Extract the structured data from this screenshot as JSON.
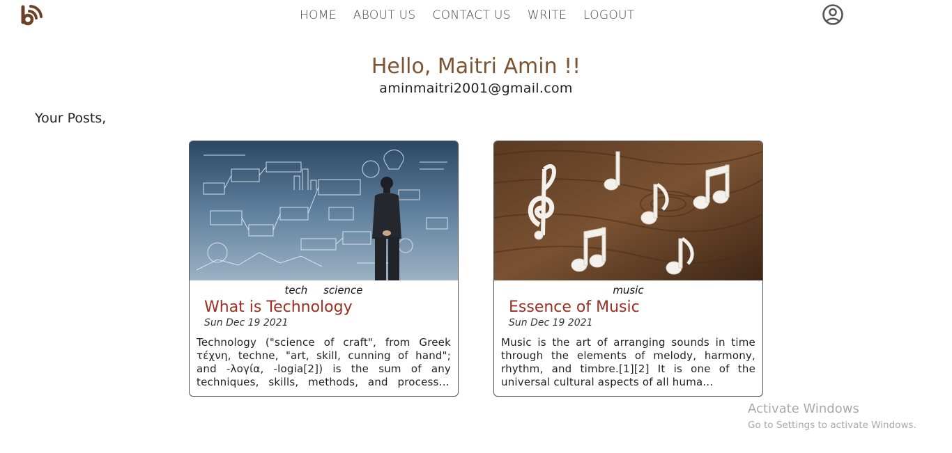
{
  "nav": {
    "logo_icon": "blog-feed-icon",
    "items": [
      "HOME",
      "ABOUT US",
      "CONTACT US",
      "WRITE",
      "LOGOUT"
    ],
    "profile_icon": "user-circle-icon"
  },
  "profile": {
    "greeting": "Hello, Maitri Amin !!",
    "email": "aminmaitri2001@gmail.com",
    "section_label": "Your Posts,"
  },
  "posts": [
    {
      "image": "technology-blueprint-man-photo",
      "categories": [
        "tech",
        "science"
      ],
      "title": "What is Technology",
      "date": "Sun Dec 19 2021",
      "excerpt": "Technology (\"science of craft\", from Greek τέχνη, techne, \"art, skill, cunning of hand\"; and -λογία, -logia[2]) is the sum of any techniques, skills, methods, and processes used in t..."
    },
    {
      "image": "music-notes-on-wood-photo",
      "categories": [
        "music"
      ],
      "title": "Essence of Music",
      "date": "Sun Dec 19 2021",
      "excerpt": "Music is the art of arranging sounds in time through the elements of melody, harmony, rhythm, and timbre.[1][2] It is one of the universal cultural aspects of all huma..."
    }
  ],
  "watermark": {
    "title": "Activate Windows",
    "subtitle": "Go to Settings to activate Windows."
  },
  "colors": {
    "brand_brown": "#7b5432",
    "post_title": "#9b2f22"
  }
}
